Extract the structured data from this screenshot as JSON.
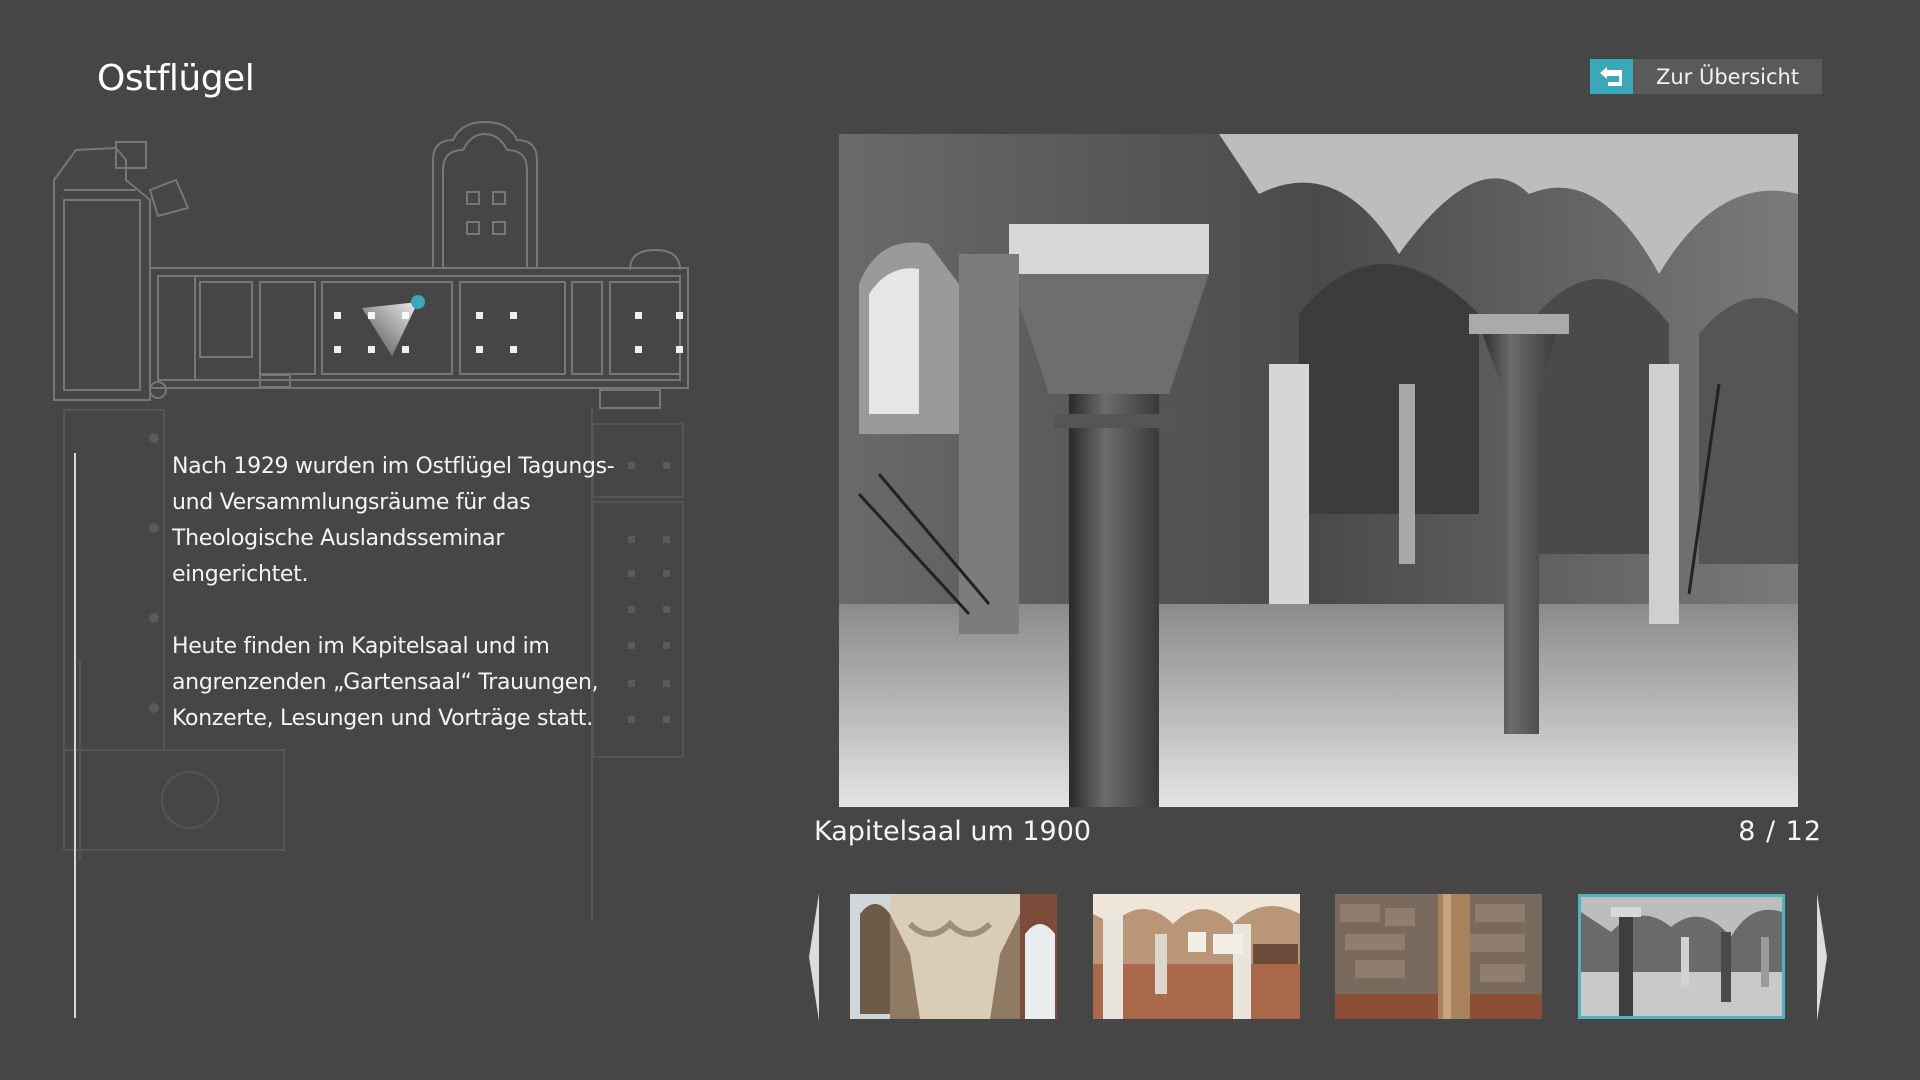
{
  "header": {
    "title": "Ostflügel",
    "back_label": "Zur Übersicht"
  },
  "icons": {
    "back": "return-arrow-icon",
    "prev": "chevron-left-icon",
    "next": "chevron-right-icon",
    "location": "viewpoint-marker-icon"
  },
  "description": {
    "paragraph_1": "Nach 1929 wurden im Ostflügel Tagungs- und Versammlungsräume für das Theologische Auslandsseminar eingerichtet.",
    "paragraph_2": "Heute finden im Kapitelsaal und im angrenzenden „Gartensaal“ Trauungen, Konzerte, Lesungen und Vorträge statt."
  },
  "gallery": {
    "caption": "Kapitelsaal um 1900",
    "counter": "8 / 12",
    "current": 8,
    "total": 12,
    "thumbnails": [
      {
        "subject": "carved-capital",
        "active": false
      },
      {
        "subject": "garden-hall",
        "active": false
      },
      {
        "subject": "stone-wall-column",
        "active": false
      },
      {
        "subject": "chapter-hall-historic",
        "active": true
      }
    ]
  },
  "colors": {
    "background": "#464646",
    "accent": "#3aa8b9",
    "button": "#5a5a5a",
    "text": "#ffffff"
  }
}
